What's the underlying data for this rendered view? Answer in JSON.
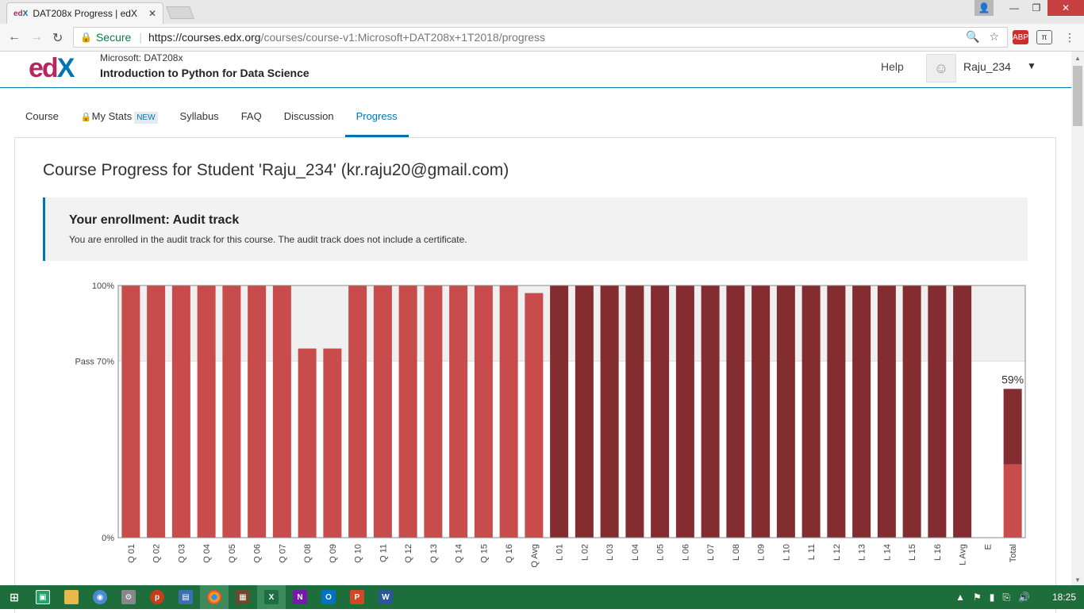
{
  "browser": {
    "tab_title": "DAT208x Progress | edX",
    "tab_favicon": "edX",
    "secure_label": "Secure",
    "url_host": "https://courses.edx.org",
    "url_path": "/courses/course-v1:Microsoft+DAT208x+1T2018/progress"
  },
  "header": {
    "course_org": "Microsoft: DAT208x",
    "course_name": "Introduction to Python for Data Science",
    "help": "Help",
    "username": "Raju_234"
  },
  "course_tabs": [
    {
      "label": "Course"
    },
    {
      "label": "My Stats",
      "badge": "NEW"
    },
    {
      "label": "Syllabus"
    },
    {
      "label": "FAQ"
    },
    {
      "label": "Discussion"
    },
    {
      "label": "Progress",
      "active": true
    }
  ],
  "page_title": "Course Progress for Student 'Raju_234' (kr.raju20@gmail.com)",
  "enrollment": {
    "heading": "Your enrollment: Audit track",
    "text": "You are enrolled in the audit track for this course. The audit track does not include a certificate."
  },
  "chart_data": {
    "type": "bar",
    "categories": [
      "Q 01",
      "Q 02",
      "Q 03",
      "Q 04",
      "Q 05",
      "Q 06",
      "Q 07",
      "Q 08",
      "Q 09",
      "Q 10",
      "Q 11",
      "Q 12",
      "Q 13",
      "Q 14",
      "Q 15",
      "Q 16",
      "Q Avg",
      "L 01",
      "L 02",
      "L 03",
      "L 04",
      "L 05",
      "L 06",
      "L 07",
      "L 08",
      "L 09",
      "L 10",
      "L 11",
      "L 12",
      "L 13",
      "L 14",
      "L 15",
      "L 16",
      "L Avg",
      "E",
      "Total"
    ],
    "values": [
      100,
      100,
      100,
      100,
      100,
      100,
      100,
      75,
      75,
      100,
      100,
      100,
      100,
      100,
      100,
      100,
      97,
      100,
      100,
      100,
      100,
      100,
      100,
      100,
      100,
      100,
      100,
      100,
      100,
      100,
      100,
      100,
      100,
      100,
      0,
      59
    ],
    "series_colors": {
      "quiz": "#c94c4c",
      "lab": "#832d30"
    },
    "total_breakdown": {
      "quiz": 29,
      "lab": 30
    },
    "total_label": "59%",
    "ytick_labels": [
      "100%",
      "Pass 70%",
      "0%"
    ],
    "ylim": [
      0,
      100
    ],
    "pass_mark": 70
  },
  "taskbar": {
    "time": "18:25",
    "apps": [
      "start",
      "excel-green",
      "file-explorer",
      "maps",
      "tools",
      "powerpoint-p",
      "paint",
      "chrome",
      "image-viewer",
      "excel",
      "onenote",
      "outlook",
      "powerpoint",
      "word"
    ]
  }
}
